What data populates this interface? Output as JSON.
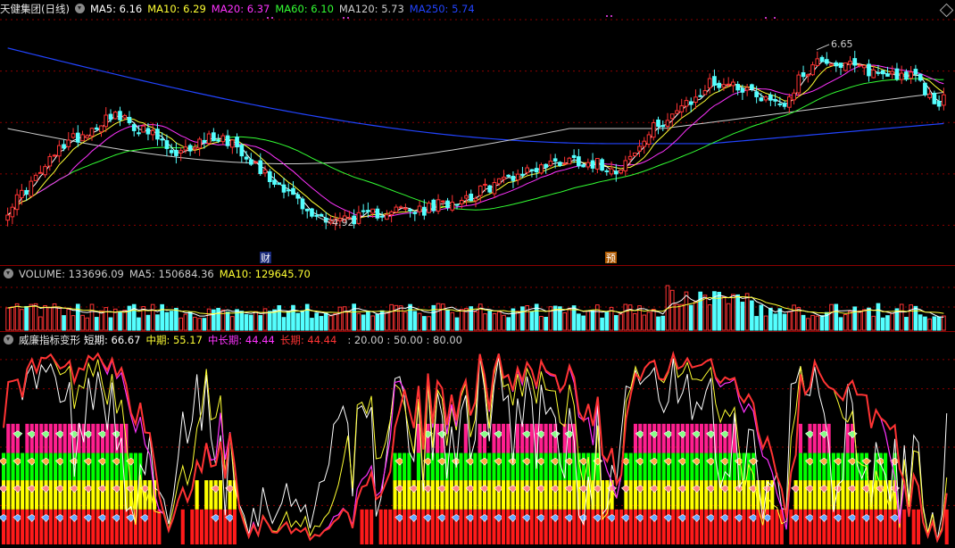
{
  "main": {
    "legend": {
      "title": "天健集团(日线)",
      "items": [
        {
          "label": "MA5:",
          "value": "6.16",
          "color": "#ffffff"
        },
        {
          "label": "MA10:",
          "value": "6.29",
          "color": "#ffff33"
        },
        {
          "label": "MA20:",
          "value": "6.37",
          "color": "#ff33ff"
        },
        {
          "label": "MA60:",
          "value": "6.10",
          "color": "#33ff33"
        },
        {
          "label": "MA120:",
          "value": "5.73",
          "color": "#cccccc"
        },
        {
          "label": "MA250:",
          "value": "5.74",
          "color": "#2244ff"
        }
      ]
    },
    "high_label": "6.65",
    "low_label": "4.92",
    "marker_cai": "财",
    "marker_yu": "预"
  },
  "volume": {
    "legend": {
      "items": [
        {
          "label": "VOLUME:",
          "value": "133696.09",
          "color": "#cccccc"
        },
        {
          "label": "MA5:",
          "value": "150684.36",
          "color": "#cccccc"
        },
        {
          "label": "MA10:",
          "value": "129645.70",
          "color": "#ffff33"
        }
      ]
    }
  },
  "indicator": {
    "legend": {
      "title": "威廉指标变形",
      "items": [
        {
          "label": "短期:",
          "value": "66.67",
          "color": "#ffffff"
        },
        {
          "label": "中期:",
          "value": "55.17",
          "color": "#ffff33"
        },
        {
          "label": "中长期:",
          "value": "44.44",
          "color": "#ff33ff"
        },
        {
          "label": "长期:",
          "value": "44.44",
          "color": "#ff3333"
        }
      ],
      "levels": ": 20.00 : 50.00 : 80.00"
    }
  },
  "colors": {
    "up": "#ff3333",
    "down": "#54ffff",
    "grid": "#8b0000",
    "ma5": "#ffffff",
    "ma10": "#ffff33",
    "ma20": "#ff33ff",
    "ma60": "#33ff33",
    "ma120": "#cccccc",
    "ma250": "#2244ff",
    "band_pink": "#ff1f8f",
    "band_green": "#00ff00",
    "band_yellow": "#ffff00",
    "band_red": "#ff1a1a"
  },
  "chart_data": [
    {
      "type": "candlestick",
      "ylim": [
        4.6,
        6.95
      ],
      "close_anchors": [
        [
          0,
          5.05
        ],
        [
          6,
          5.35
        ],
        [
          12,
          5.7
        ],
        [
          18,
          5.85
        ],
        [
          22,
          6.0
        ],
        [
          26,
          5.9
        ],
        [
          32,
          5.75
        ],
        [
          36,
          5.55
        ],
        [
          40,
          5.7
        ],
        [
          44,
          5.78
        ],
        [
          48,
          5.72
        ],
        [
          52,
          5.55
        ],
        [
          56,
          5.35
        ],
        [
          60,
          5.25
        ],
        [
          64,
          5.0
        ],
        [
          70,
          4.95
        ],
        [
          76,
          4.97
        ],
        [
          82,
          5.05
        ],
        [
          88,
          5.02
        ],
        [
          94,
          5.12
        ],
        [
          100,
          5.2
        ],
        [
          106,
          5.35
        ],
        [
          112,
          5.45
        ],
        [
          116,
          5.5
        ],
        [
          120,
          5.55
        ],
        [
          126,
          5.5
        ],
        [
          130,
          5.45
        ],
        [
          134,
          5.6
        ],
        [
          138,
          5.85
        ],
        [
          142,
          6.0
        ],
        [
          146,
          6.1
        ],
        [
          150,
          6.3
        ],
        [
          154,
          6.3
        ],
        [
          158,
          6.25
        ],
        [
          162,
          6.15
        ],
        [
          166,
          6.1
        ],
        [
          170,
          6.4
        ],
        [
          174,
          6.55
        ],
        [
          178,
          6.48
        ],
        [
          182,
          6.45
        ],
        [
          186,
          6.4
        ],
        [
          190,
          6.4
        ],
        [
          194,
          6.35
        ],
        [
          198,
          6.1
        ],
        [
          200,
          6.16
        ]
      ],
      "count": 201,
      "high": 6.65,
      "low": 4.92
    },
    {
      "type": "bar",
      "name": "VOLUME",
      "last_value": 133696.09,
      "ma5": 150684.36,
      "ma10": 129645.7
    },
    {
      "type": "line",
      "ylim": [
        0,
        100
      ],
      "levels": [
        20,
        50,
        80
      ],
      "series": [
        {
          "name": "短期",
          "last": 66.67
        },
        {
          "name": "中期",
          "last": 55.17
        },
        {
          "name": "中长期",
          "last": 44.44
        },
        {
          "name": "长期",
          "last": 44.44
        }
      ]
    }
  ]
}
